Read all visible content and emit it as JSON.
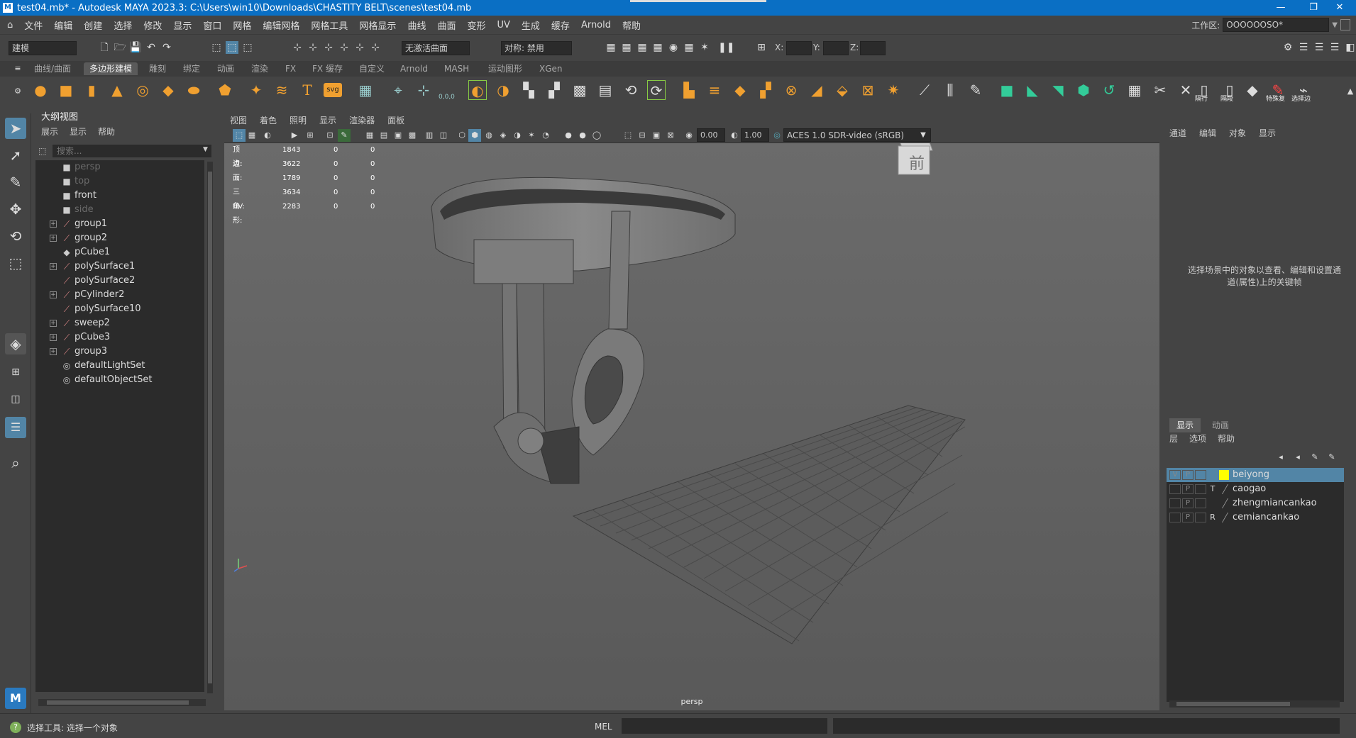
{
  "window": {
    "title": "test04.mb* - Autodesk MAYA 2023.3: C:\\Users\\win10\\Downloads\\CHASTITY BELT\\scenes\\test04.mb",
    "logo": "M"
  },
  "menubar": {
    "items": [
      "文件",
      "编辑",
      "创建",
      "选择",
      "修改",
      "显示",
      "窗口",
      "网格",
      "编辑网格",
      "网格工具",
      "网格显示",
      "曲线",
      "曲面",
      "变形",
      "UV",
      "生成",
      "缓存",
      "Arnold",
      "帮助"
    ],
    "workspace_label": "工作区:",
    "workspace_value": "OOOOOOSO*"
  },
  "statusline": {
    "mode": "建模",
    "live_surface": "无激活曲面",
    "symmetry": "对称: 禁用",
    "x_label": "X:",
    "y_label": "Y:",
    "z_label": "Z:"
  },
  "shelf": {
    "tabs": [
      "曲线/曲面",
      "多边形建模",
      "雕刻",
      "绑定",
      "动画",
      "渲染",
      "FX",
      "FX 缓存",
      "自定义",
      "Arnold",
      "MASH",
      "运动图形",
      "XGen"
    ],
    "active_tab": 1,
    "labels": {
      "origin": "0,0,0",
      "svg": "svg",
      "hide": "隔行",
      "unhide": "隔段",
      "special": "特殊复",
      "select_edge": "选择边"
    }
  },
  "outliner": {
    "title": "大纲视图",
    "menu": [
      "展示",
      "显示",
      "帮助"
    ],
    "search_placeholder": "搜索...",
    "items": [
      {
        "label": "persp",
        "icon": "camera-icon",
        "expand": false,
        "dim": true
      },
      {
        "label": "top",
        "icon": "camera-icon",
        "expand": false,
        "dim": true
      },
      {
        "label": "front",
        "icon": "camera-icon",
        "expand": false,
        "dim": false
      },
      {
        "label": "side",
        "icon": "camera-icon",
        "expand": false,
        "dim": true
      },
      {
        "label": "group1",
        "icon": "group-icon",
        "expand": true,
        "dim": false
      },
      {
        "label": "group2",
        "icon": "group-icon",
        "expand": true,
        "dim": false
      },
      {
        "label": "pCube1",
        "icon": "mesh-icon",
        "expand": false,
        "dim": false
      },
      {
        "label": "polySurface1",
        "icon": "group-icon",
        "expand": true,
        "dim": false
      },
      {
        "label": "polySurface2",
        "icon": "group-icon",
        "expand": false,
        "dim": false
      },
      {
        "label": "pCylinder2",
        "icon": "group-icon",
        "expand": true,
        "dim": false
      },
      {
        "label": "polySurface10",
        "icon": "group-icon",
        "expand": false,
        "dim": false
      },
      {
        "label": "sweep2",
        "icon": "group-icon",
        "expand": true,
        "dim": false
      },
      {
        "label": "pCube3",
        "icon": "group-icon",
        "expand": true,
        "dim": false
      },
      {
        "label": "group3",
        "icon": "group-icon",
        "expand": true,
        "dim": false
      },
      {
        "label": "defaultLightSet",
        "icon": "set-icon",
        "expand": false,
        "dim": false
      },
      {
        "label": "defaultObjectSet",
        "icon": "set-icon",
        "expand": false,
        "dim": false
      }
    ]
  },
  "viewport": {
    "menu": [
      "视图",
      "着色",
      "照明",
      "显示",
      "渲染器",
      "面板"
    ],
    "exposure": "0.00",
    "gamma": "1.00",
    "color_space": "ACES 1.0 SDR-video (sRGB)",
    "camera": "persp",
    "viewcube_label": "前",
    "hud": [
      {
        "label": "顶点:",
        "v1": "1843",
        "v2": "0",
        "v3": "0"
      },
      {
        "label": "边:",
        "v1": "3622",
        "v2": "0",
        "v3": "0"
      },
      {
        "label": "面:",
        "v1": "1789",
        "v2": "0",
        "v3": "0"
      },
      {
        "label": "三角形:",
        "v1": "3634",
        "v2": "0",
        "v3": "0"
      },
      {
        "label": "UV:",
        "v1": "2283",
        "v2": "0",
        "v3": "0"
      }
    ]
  },
  "channelbox": {
    "menu": [
      "通道",
      "编辑",
      "对象",
      "显示"
    ],
    "hint": "选择场景中的对象以查看、编辑和设置通道(属性)上的关键帧"
  },
  "layers": {
    "tabs": [
      "显示",
      "动画"
    ],
    "menu": [
      "层",
      "选项",
      "帮助"
    ],
    "rows": [
      {
        "v": "V",
        "p": "P",
        "type": "",
        "name": "beiyong",
        "color": "#ffff00",
        "selected": true
      },
      {
        "v": "",
        "p": "P",
        "type": "T",
        "name": "caogao",
        "color": "",
        "selected": false
      },
      {
        "v": "",
        "p": "P",
        "type": "",
        "name": "zhengmiancankao",
        "color": "",
        "selected": false
      },
      {
        "v": "",
        "p": "P",
        "type": "R",
        "name": "cemiancankao",
        "color": "",
        "selected": false
      }
    ]
  },
  "helpline": {
    "message": "选择工具: 选择一个对象",
    "mel_label": "MEL"
  }
}
